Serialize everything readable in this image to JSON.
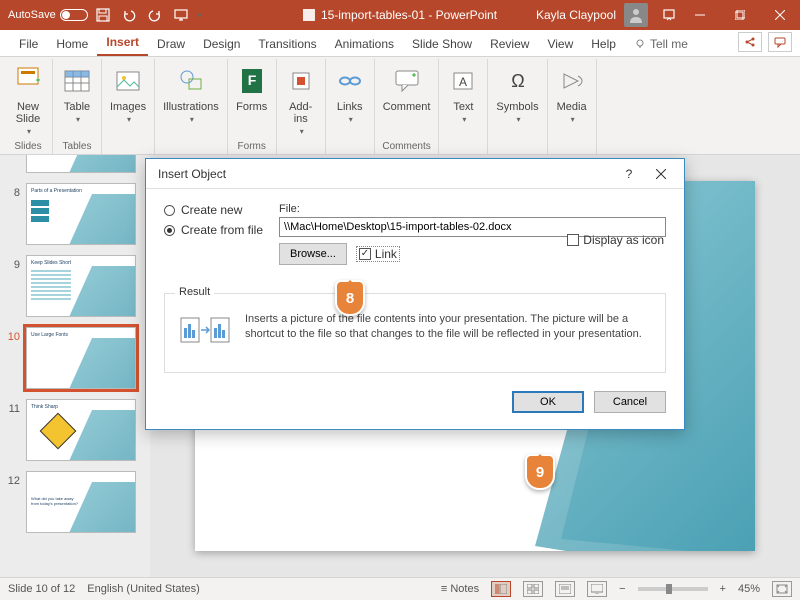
{
  "titlebar": {
    "autosave_label": "AutoSave",
    "doc_title": "15-import-tables-01 - PowerPoint",
    "user_name": "Kayla Claypool"
  },
  "ribbon_tabs": [
    "File",
    "Home",
    "Insert",
    "Draw",
    "Design",
    "Transitions",
    "Animations",
    "Slide Show",
    "Review",
    "View",
    "Help"
  ],
  "active_tab": "Insert",
  "tell_me": "Tell me",
  "ribbon_groups": {
    "slides": {
      "label": "Slides",
      "new_slide": "New\nSlide"
    },
    "tables": {
      "label": "Tables",
      "table": "Table"
    },
    "images": "Images",
    "illustrations": "Illustrations",
    "forms": {
      "label": "Forms",
      "forms": "Forms"
    },
    "addins": "Add-\nins",
    "links": "Links",
    "comment": {
      "label": "Comments",
      "comment": "Comment"
    },
    "text": "Text",
    "symbols": "Symbols",
    "media": "Media"
  },
  "thumbnails": [
    {
      "num": "8"
    },
    {
      "num": "9"
    },
    {
      "num": "10",
      "selected": true
    },
    {
      "num": "11"
    },
    {
      "num": "12"
    }
  ],
  "dialog": {
    "title": "Insert Object",
    "create_new": "Create new",
    "create_from_file": "Create from file",
    "file_label": "File:",
    "file_path": "\\\\Mac\\Home\\Desktop\\15-import-tables-02.docx",
    "browse": "Browse...",
    "link": "Link",
    "display_as_icon": "Display as icon",
    "result_label": "Result",
    "result_text": "Inserts a picture of the file contents into your presentation. The picture will be a shortcut to the file so that changes to the file will be reflected in your presentation.",
    "ok": "OK",
    "cancel": "Cancel"
  },
  "callouts": {
    "c8": "8",
    "c9": "9"
  },
  "statusbar": {
    "slide_info": "Slide 10 of 12",
    "language": "English (United States)",
    "notes": "Notes",
    "zoom": "45%"
  }
}
